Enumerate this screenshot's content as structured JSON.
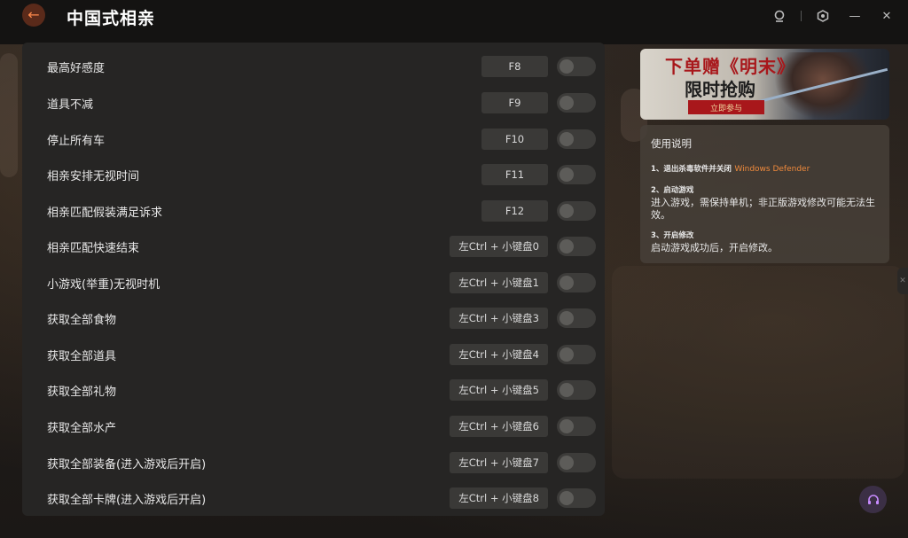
{
  "app": {
    "title": "中国式相亲"
  },
  "titlebar": {
    "back_icon": "arrow-left-icon",
    "controls": [
      "user-icon",
      "settings-icon",
      "minimize-icon",
      "close-icon"
    ]
  },
  "cheats": [
    {
      "label": "最高好感度",
      "hotkey": "F8"
    },
    {
      "label": "道具不减",
      "hotkey": "F9"
    },
    {
      "label": "停止所有车",
      "hotkey": "F10"
    },
    {
      "label": "相亲安排无视时间",
      "hotkey": "F11"
    },
    {
      "label": "相亲匹配假装满足诉求",
      "hotkey": "F12"
    },
    {
      "label": "相亲匹配快速结束",
      "hotkey": "左Ctrl + 小键盘0"
    },
    {
      "label": "小游戏(举重)无视时机",
      "hotkey": "左Ctrl + 小键盘1"
    },
    {
      "label": "获取全部食物",
      "hotkey": "左Ctrl + 小键盘3"
    },
    {
      "label": "获取全部道具",
      "hotkey": "左Ctrl + 小键盘4"
    },
    {
      "label": "获取全部礼物",
      "hotkey": "左Ctrl + 小键盘5"
    },
    {
      "label": "获取全部水产",
      "hotkey": "左Ctrl + 小键盘6"
    },
    {
      "label": "获取全部装备(进入游戏后开启)",
      "hotkey": "左Ctrl + 小键盘7"
    },
    {
      "label": "获取全部卡牌(进入游戏后开启)",
      "hotkey": "左Ctrl + 小键盘8"
    }
  ],
  "banner": {
    "line1": "下单赠《明末》",
    "line2": "限时抢购",
    "button": "立即参与"
  },
  "instructions": {
    "title": "使用说明",
    "step1_head": "1、退出杀毒软件并关闭",
    "step1_accent": "Windows Defender",
    "step2_head": "2、启动游戏",
    "step2_body": "进入游戏，需保持单机；非正版游戏修改可能无法生效。",
    "step3_head": "3、开启修改",
    "step3_body": "启动游戏成功后，开启修改。"
  },
  "colors": {
    "accent": "#f08a3c",
    "panel": "#262524",
    "support": "#c88bff"
  }
}
